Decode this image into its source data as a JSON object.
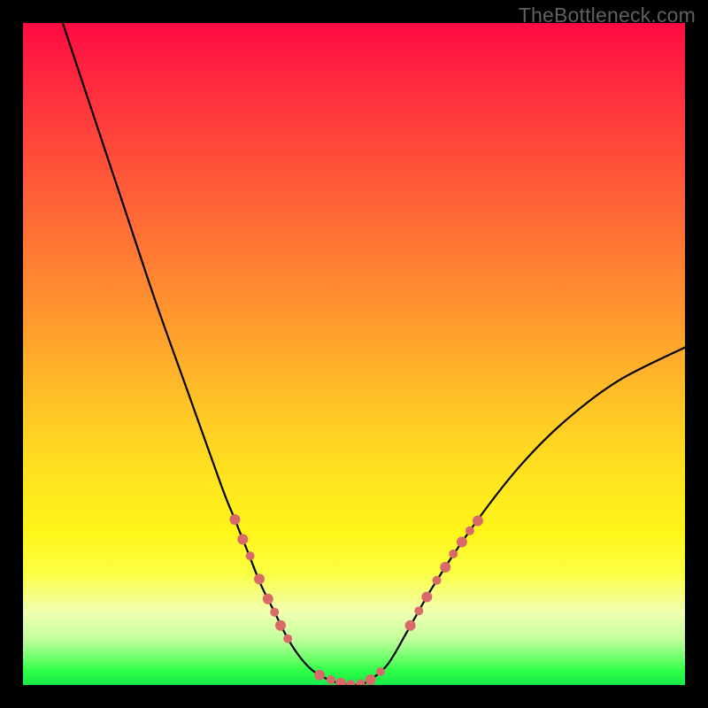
{
  "attribution": "TheBottleneck.com",
  "chart_data": {
    "type": "line",
    "title": "",
    "xlabel": "",
    "ylabel": "",
    "xlim": [
      0,
      100
    ],
    "ylim": [
      0,
      100
    ],
    "series": [
      {
        "name": "bottleneck-curve",
        "x": [
          6,
          10,
          15,
          20,
          25,
          30,
          32,
          34,
          36,
          38,
          40,
          42,
          44,
          47,
          50,
          52,
          55,
          58,
          62,
          68,
          75,
          82,
          90,
          100
        ],
        "y": [
          100,
          88,
          73,
          58,
          44,
          30,
          25,
          20,
          15,
          11,
          7,
          4,
          2,
          0.5,
          0,
          0.5,
          3,
          8,
          15,
          24,
          33,
          40,
          46,
          51
        ]
      }
    ],
    "markers": {
      "name": "highlighted-points",
      "color": "#d86a6a",
      "points": [
        {
          "x": 32.0,
          "y": 25.0,
          "r": 6
        },
        {
          "x": 33.2,
          "y": 22.0,
          "r": 6
        },
        {
          "x": 34.3,
          "y": 19.5,
          "r": 5
        },
        {
          "x": 35.7,
          "y": 16.0,
          "r": 6
        },
        {
          "x": 37.0,
          "y": 13.0,
          "r": 6
        },
        {
          "x": 38.0,
          "y": 11.0,
          "r": 5
        },
        {
          "x": 38.9,
          "y": 9.0,
          "r": 6
        },
        {
          "x": 40.0,
          "y": 7.0,
          "r": 5
        },
        {
          "x": 44.8,
          "y": 1.5,
          "r": 6
        },
        {
          "x": 46.5,
          "y": 0.8,
          "r": 5
        },
        {
          "x": 48.0,
          "y": 0.3,
          "r": 6
        },
        {
          "x": 49.5,
          "y": 0.1,
          "r": 5
        },
        {
          "x": 51.0,
          "y": 0.2,
          "r": 5
        },
        {
          "x": 52.5,
          "y": 0.8,
          "r": 6
        },
        {
          "x": 54.0,
          "y": 2.0,
          "r": 5
        },
        {
          "x": 58.5,
          "y": 9.0,
          "r": 6
        },
        {
          "x": 59.8,
          "y": 11.2,
          "r": 5
        },
        {
          "x": 61.0,
          "y": 13.3,
          "r": 6
        },
        {
          "x": 62.5,
          "y": 15.8,
          "r": 5
        },
        {
          "x": 63.8,
          "y": 17.8,
          "r": 6
        },
        {
          "x": 65.0,
          "y": 19.8,
          "r": 5
        },
        {
          "x": 66.3,
          "y": 21.6,
          "r": 6
        },
        {
          "x": 67.5,
          "y": 23.3,
          "r": 5
        },
        {
          "x": 68.7,
          "y": 24.8,
          "r": 6
        }
      ]
    },
    "gradient_stops": [
      {
        "pos": 0,
        "color": "#ff0b43"
      },
      {
        "pos": 22,
        "color": "#ff5339"
      },
      {
        "pos": 48,
        "color": "#ffa32c"
      },
      {
        "pos": 69,
        "color": "#ffe51f"
      },
      {
        "pos": 89,
        "color": "#f1ffb2"
      },
      {
        "pos": 100,
        "color": "#17e84a"
      }
    ]
  }
}
